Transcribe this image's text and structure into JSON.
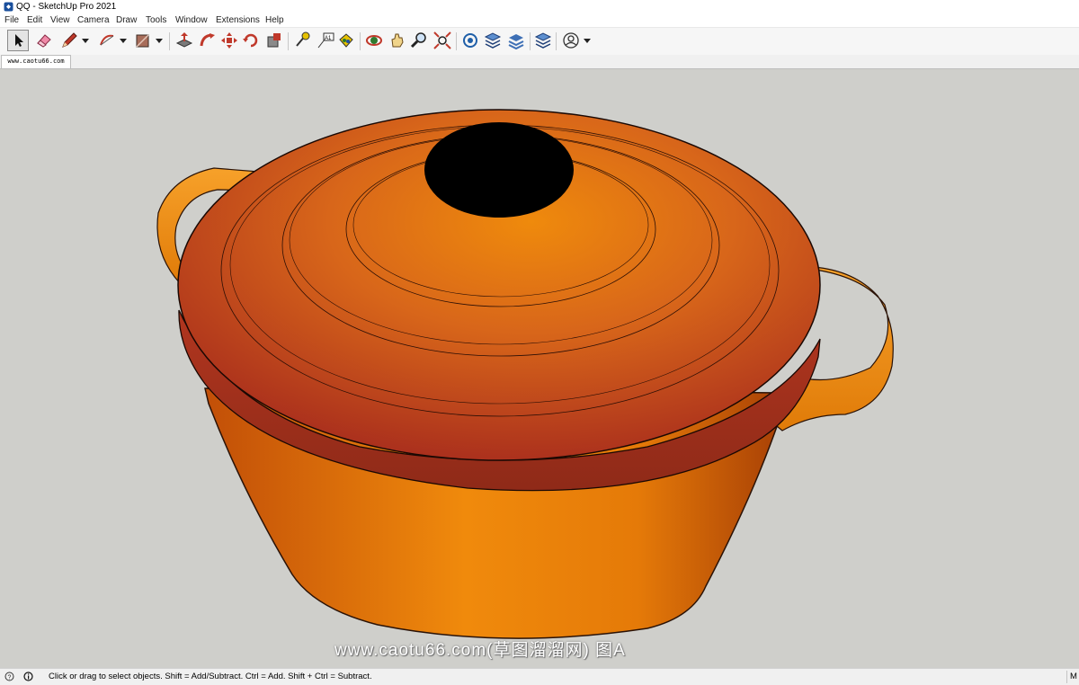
{
  "window": {
    "title": "QQ - SketchUp Pro 2021"
  },
  "menu": {
    "items": [
      "File",
      "Edit",
      "View",
      "Camera",
      "Draw",
      "Tools",
      "Window",
      "Extensions",
      "Help"
    ]
  },
  "toolbar": {
    "tools": [
      {
        "name": "select-tool",
        "icon": "arrow-cursor-icon"
      },
      {
        "name": "eraser-tool",
        "icon": "eraser-icon"
      },
      {
        "name": "line-tool",
        "icon": "pencil-icon"
      },
      {
        "name": "arc-tool",
        "icon": "arc-icon"
      },
      {
        "name": "shape-tool",
        "icon": "rectangle-icon"
      },
      {
        "name": "push-pull-tool",
        "icon": "push-pull-icon"
      },
      {
        "name": "follow-me-tool",
        "icon": "follow-me-icon"
      },
      {
        "name": "move-tool",
        "icon": "move-icon"
      },
      {
        "name": "rotate-tool",
        "icon": "rotate-icon"
      },
      {
        "name": "scale-tool",
        "icon": "scale-icon"
      },
      {
        "name": "tape-measure-tool",
        "icon": "tape-measure-icon"
      },
      {
        "name": "text-tool",
        "icon": "text-icon"
      },
      {
        "name": "paint-bucket-tool",
        "icon": "paint-bucket-icon"
      },
      {
        "name": "orbit-tool",
        "icon": "orbit-icon"
      },
      {
        "name": "pan-tool",
        "icon": "hand-icon"
      },
      {
        "name": "zoom-tool",
        "icon": "magnifier-icon"
      },
      {
        "name": "zoom-extents-tool",
        "icon": "zoom-extents-icon"
      },
      {
        "name": "3d-warehouse-tool",
        "icon": "warehouse-icon"
      },
      {
        "name": "extension-warehouse-tool",
        "icon": "extension-warehouse-icon"
      },
      {
        "name": "layout-tool",
        "icon": "layout-icon"
      },
      {
        "name": "extension-manager-tool",
        "icon": "extension-manager-icon"
      },
      {
        "name": "account-button",
        "icon": "user-icon"
      }
    ],
    "text_tool_label": "A1"
  },
  "document_tab": {
    "label": "www.caotu66.com"
  },
  "watermark": {
    "text": "www.caotu66.com(草图溜溜网) 图A"
  },
  "status": {
    "message": "Click or drag to select objects. Shift = Add/Subtract. Ctrl = Add. Shift + Ctrl = Subtract.",
    "right_label": "M",
    "icons": [
      "geo-location-icon",
      "info-icon",
      "user-credit-icon"
    ]
  },
  "colors": {
    "background": "#cfcfcb",
    "pot_orange": "#ea7c0a",
    "lid_red": "#b2351f",
    "knob": "#000000"
  }
}
